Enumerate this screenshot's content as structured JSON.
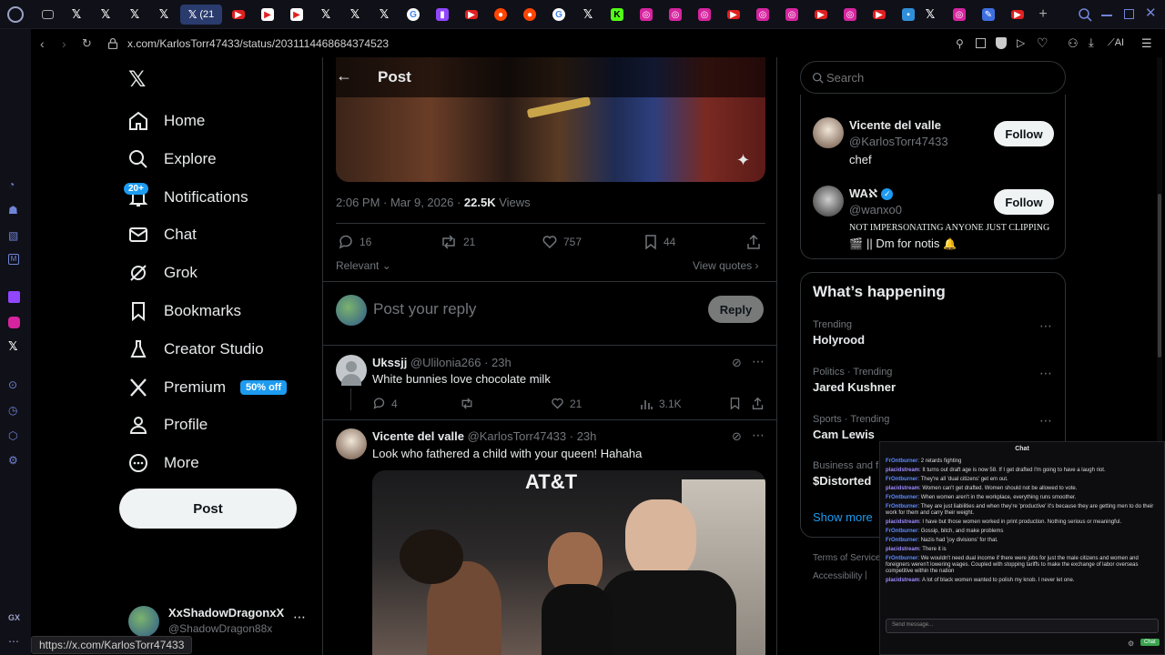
{
  "browser": {
    "active_tab_label": "(21",
    "url": "x.com/KarlosTorr47433/status/2031114468684374523",
    "ai_label": "AI",
    "status_url": "https://x.com/KarlosTorr47433",
    "gx_label": "GX",
    "accent": "#2a3c6e"
  },
  "nav": {
    "items": [
      {
        "label": "Home",
        "icon": "home-icon"
      },
      {
        "label": "Explore",
        "icon": "search-icon"
      },
      {
        "label": "Notifications",
        "icon": "bell-icon"
      },
      {
        "label": "Chat",
        "icon": "mail-icon"
      },
      {
        "label": "Grok",
        "icon": "grok-icon"
      },
      {
        "label": "Bookmarks",
        "icon": "bookmark-icon"
      },
      {
        "label": "Creator Studio",
        "icon": "flask-icon"
      },
      {
        "label": "Premium",
        "icon": "x-icon"
      },
      {
        "label": "Profile",
        "icon": "person-icon"
      },
      {
        "label": "More",
        "icon": "more-circle-icon"
      }
    ],
    "notif_badge": "20+",
    "premium_badge": "50% off",
    "post_button": "Post",
    "account": {
      "name": "XxShadowDragonxX",
      "handle": "@ShadowDragon88x"
    }
  },
  "header": {
    "title": "Post"
  },
  "post": {
    "time": "2:06 PM · Mar 9, 2026 · ",
    "views_count": "22.5K",
    "views_label": " Views",
    "replies": "16",
    "reposts": "21",
    "likes": "757",
    "bookmarks": "44",
    "sort_label": "Relevant",
    "view_quotes": "View quotes"
  },
  "reply_box": {
    "placeholder": "Post your reply",
    "button": "Reply"
  },
  "replies": [
    {
      "name": "Ukssjj",
      "handle": "@Ulilonia266 · 23h",
      "text": "White bunnies love chocolate milk",
      "replies": "4",
      "likes": "21",
      "views": "3.1K"
    },
    {
      "name": "Vicente del valle",
      "handle": "@KarlosTorr47433 · 23h",
      "text": "Look who fathered a child with your queen! Hahaha",
      "image_sign": "AT&T"
    }
  ],
  "sidebar": {
    "search_placeholder": "Search",
    "who_to_follow": [
      {
        "name": "Vicente del valle",
        "handle": "@KarlosTorr47433",
        "bio": "chef",
        "button": "Follow"
      },
      {
        "name": "WAℵ",
        "handle": "@wanxo0",
        "bio1": "NOT IMPERSONATING ANYONE JUST CLIPPING",
        "bio2": "|| Dm for notis",
        "button": "Follow"
      }
    ],
    "happening_title": "What’s happening",
    "trends": [
      {
        "meta": "Trending",
        "name": "Holyrood"
      },
      {
        "meta": "Politics · Trending",
        "name": "Jared Kushner"
      },
      {
        "meta": "Sports · Trending",
        "name": "Cam Lewis"
      },
      {
        "meta": "Business and f",
        "name": "$Distorted"
      }
    ],
    "show_more": "Show more",
    "footer_terms": "Terms of Service",
    "footer_access": "Accessibility"
  },
  "chat": {
    "title": "Chat",
    "messages": [
      {
        "user": "FrOntburner",
        "text": "2 retards fighting"
      },
      {
        "user": "placidstream",
        "text": "It turns out draft age is now 58. If I get drafted I'm going to have a laugh riot."
      },
      {
        "user": "FrOntburner",
        "text": "They're all 'dual citizens' get em out."
      },
      {
        "user": "placidstream",
        "text": "Women can't get drafted. Women should not be allowed to vote."
      },
      {
        "user": "FrOntburner",
        "text": "When women aren't in the workplace, everything runs smoother."
      },
      {
        "user": "FrOntburner",
        "text": "They are just liabilities and when they're 'productive' it's because they are getting men to do their work for them and carry their weight."
      },
      {
        "user": "placidstream",
        "text": "I have but those women worked in print production. Nothing serious or meaningful."
      },
      {
        "user": "FrOntburner",
        "text": "Gossip, bitch, and make problems"
      },
      {
        "user": "FrOntburner",
        "text": "Nazis had 'joy divisions' for that."
      },
      {
        "user": "placidstream",
        "text": "There it is"
      },
      {
        "user": "FrOntburner",
        "text": "We wouldn't need dual income if there were jobs for just the male citizens and women and foreigners weren't lowering wages. Coupled with stopping tariffs to make the exchange of labor overseas competitive within the nation"
      },
      {
        "user": "placidstream",
        "text": "A lot of black women wanted to polish my knob. I never let one."
      }
    ],
    "input_placeholder": "Send message...",
    "send_label": "Chat"
  }
}
